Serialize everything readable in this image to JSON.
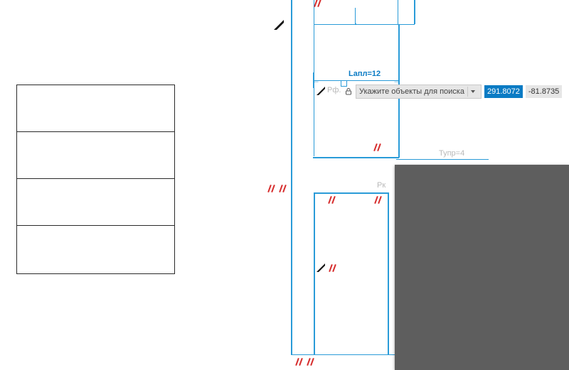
{
  "left_table": {
    "rows": 4
  },
  "drawing": {
    "labels": {
      "dim_lapl": "Lапл=12",
      "rf": "Рф.",
      "tupr": "Тупр=4",
      "rk": "Рк"
    }
  },
  "float": {
    "prompt": "Укажите объекты для поиска",
    "x": "291.8072",
    "y": "-81.8735"
  },
  "icons": {
    "lock": "lock-icon",
    "chevron_down": "chevron-down-icon",
    "peel": "section-arrow-icon",
    "hatch": "hatch-mark-icon"
  }
}
